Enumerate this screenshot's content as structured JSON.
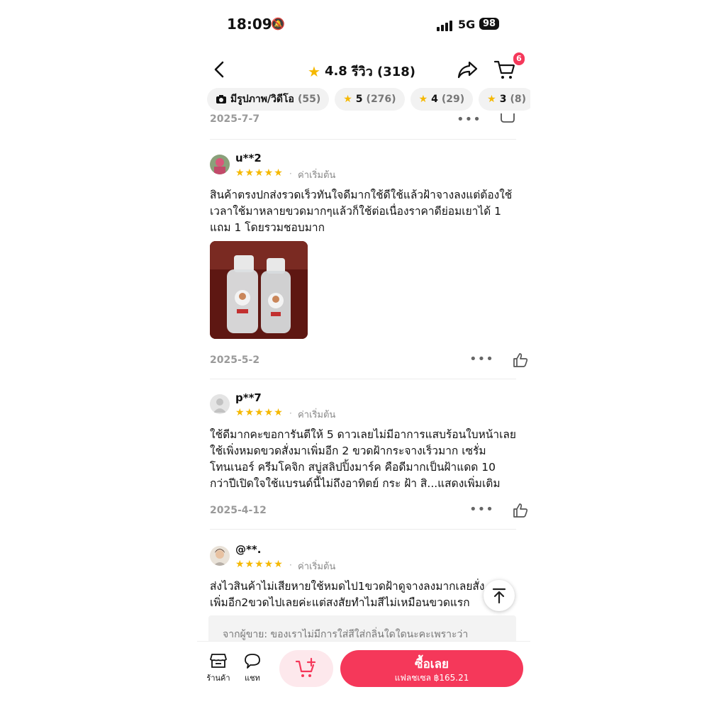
{
  "status_bar": {
    "time": "18:09",
    "network": "5G",
    "battery": "98"
  },
  "header": {
    "rating": "4.8",
    "reviews_label": "รีวิว (318)",
    "cart_count": "6"
  },
  "filters": [
    {
      "label": "มีรูปภาพ/วิดีโอ",
      "count": "(55)"
    },
    {
      "label": "5",
      "count": "(276)"
    },
    {
      "label": "4",
      "count": "(29)"
    },
    {
      "label": "3",
      "count": "(8)"
    }
  ],
  "top_date": "2025-7-7",
  "reviews": [
    {
      "user": "u**2",
      "stars": "★★★★★",
      "variant": "ค่าเริ่มต้น",
      "text": "สินค้าตรงปกส่งรวดเร็วทันใจดีมากใช้ดีใช้แล้วฝ้าจางลงแต่ต้องใช้เวลาใช้มาหลายขวดมากๆแล้วก็ใช้ต่อเนื่องราคาดีย่อมเยาได้ 1 แถม 1 โดยรวมชอบมาก",
      "date": "2025-5-2"
    },
    {
      "user": "p**7",
      "stars": "★★★★★",
      "variant": "ค่าเริ่มต้น",
      "text": "ใช้ดีมากคะขอการันตีให้ 5 ดาวเลยไม่มีอาการแสบร้อนใบหน้าเลยใช้เพิ่งหมดขวดสั่งมาเพิ่มอีก 2 ขวดฝ้ากระจางเร็วมาก เซรั่มโทนเนอร์ ครีมโคจิก สบู่สลิปปิ้งมาร์ค คือดีมากเป็นฝ้าแดด 10 กว่าปีเปิดใจใช้แบรนด์นี้ไม่ถึงอาทิตย์ กระ ฝ้า สิ...แสดงเพิ่มเติม",
      "date": "2025-4-12"
    },
    {
      "user": "@**.",
      "stars": "★★★★★",
      "variant": "ค่าเริ่มต้น",
      "text": "ส่งไวสินค้าไม่เสียหายใช้หมดไป1ขวดฝ้าดูจางลงมากเลยสั่งเพิ่มอีก2ขวดไปเลยค่ะแต่สงสัยทำไมสีไม่เหมือนขวดแรก"
    }
  ],
  "seller_reply": "จากผู้ขาย: ของเราไม่มีการใส่สีใส่กลิ่นใดใดนะคะเพราะว่า",
  "bottom_bar": {
    "shop_label": "ร้านค้า",
    "chat_label": "แชท",
    "buy_label": "ซื้อเลย",
    "buy_price": "แฟลชเซล ฿165.21"
  },
  "colors": {
    "accent": "#f5385a",
    "star": "#f5b800"
  }
}
